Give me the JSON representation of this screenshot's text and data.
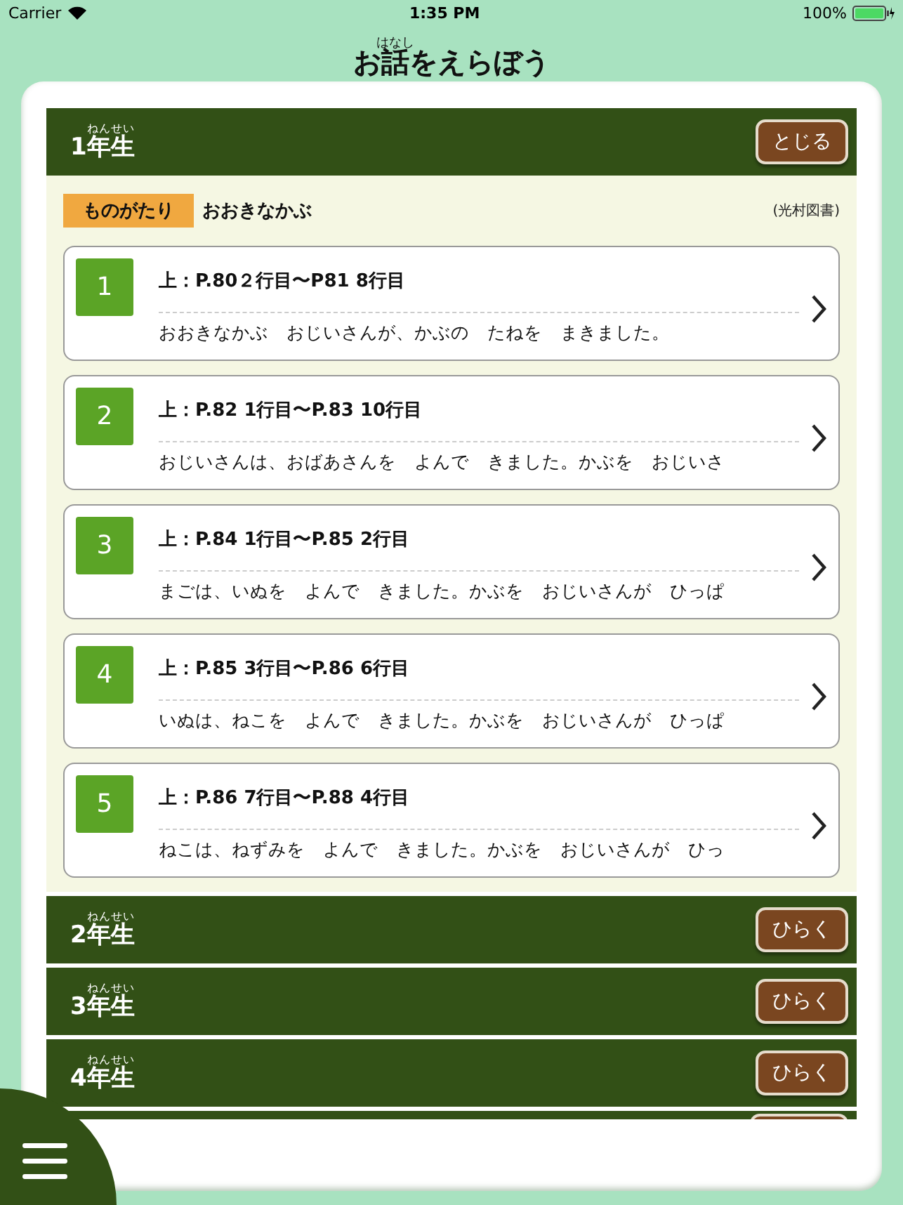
{
  "status_bar": {
    "carrier": "Carrier",
    "time": "1:35 PM",
    "battery": "100%"
  },
  "title": {
    "before": "お",
    "base": "話",
    "ruby": "はなし",
    "after": "をえらぼう"
  },
  "grades": [
    {
      "kind": "header",
      "number": "1",
      "base": "年生",
      "ruby": "ねんせい",
      "button": "とじる",
      "story": {
        "tag": "ものがたり",
        "title": "おおきなかぶ",
        "publisher": "(光村図書)",
        "sections": [
          {
            "number": "1",
            "range": "上：P.80２行目〜P81  8行目",
            "text": "おおきなかぶ　おじいさんが、かぶの　たねを　まきました。"
          },
          {
            "number": "2",
            "range": "上：P.82 1行目〜P.83 10行目",
            "text": "おじいさんは、おばあさんを　よんで　きました。かぶを　おじいさ"
          },
          {
            "number": "3",
            "range": "上：P.84 1行目〜P.85 2行目",
            "text": "まごは、いぬを　よんで　きました。かぶを　おじいさんが　ひっぱ"
          },
          {
            "number": "4",
            "range": "上：P.85 3行目〜P.86 6行目",
            "text": "いぬは、ねこを　よんで　きました。かぶを　おじいさんが　ひっぱ"
          },
          {
            "number": "5",
            "range": "上：P.86 7行目〜P.88 4行目",
            "text": "ねこは、ねずみを　よんで　きました。かぶを　おじいさんが　ひっ"
          }
        ]
      }
    },
    {
      "kind": "header",
      "number": "2",
      "base": "年生",
      "ruby": "ねんせい",
      "button": "ひらく"
    },
    {
      "kind": "header",
      "number": "3",
      "base": "年生",
      "ruby": "ねんせい",
      "button": "ひらく"
    },
    {
      "kind": "header",
      "number": "4",
      "base": "年生",
      "ruby": "ねんせい",
      "button": "ひらく"
    },
    {
      "kind": "cut"
    }
  ]
}
